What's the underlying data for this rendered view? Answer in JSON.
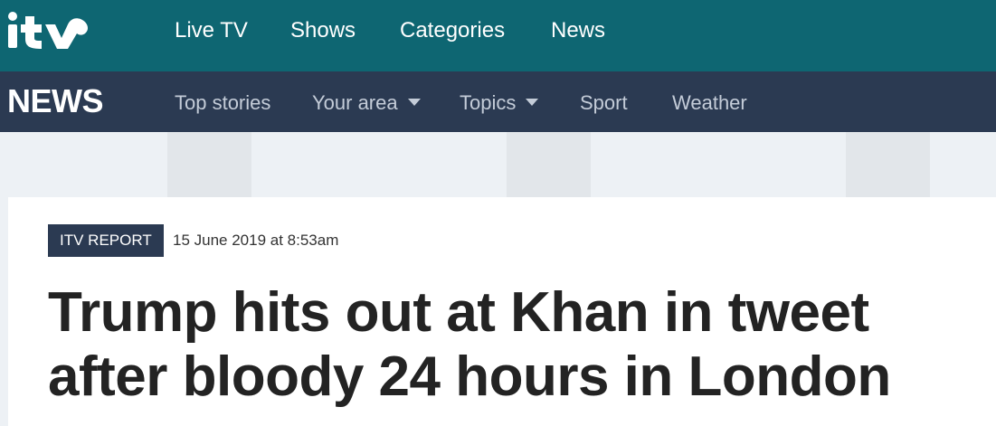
{
  "brand": {
    "logo_text": "itv",
    "primary_color": "#0e6672",
    "secondary_color": "#2b3a52"
  },
  "top_nav": {
    "items": [
      {
        "label": "Live TV"
      },
      {
        "label": "Shows"
      },
      {
        "label": "Categories"
      },
      {
        "label": "News"
      }
    ]
  },
  "news_nav": {
    "section_title": "NEWS",
    "items": [
      {
        "label": "Top stories",
        "dropdown": false
      },
      {
        "label": "Your area",
        "dropdown": true
      },
      {
        "label": "Topics",
        "dropdown": true
      },
      {
        "label": "Sport",
        "dropdown": false
      },
      {
        "label": "Weather",
        "dropdown": false
      }
    ]
  },
  "article": {
    "badge": "ITV REPORT",
    "timestamp": "15 June 2019 at 8:53am",
    "headline_line1": "Trump hits out at Khan in tweet",
    "headline_line2": "after bloody 24 hours in London"
  }
}
